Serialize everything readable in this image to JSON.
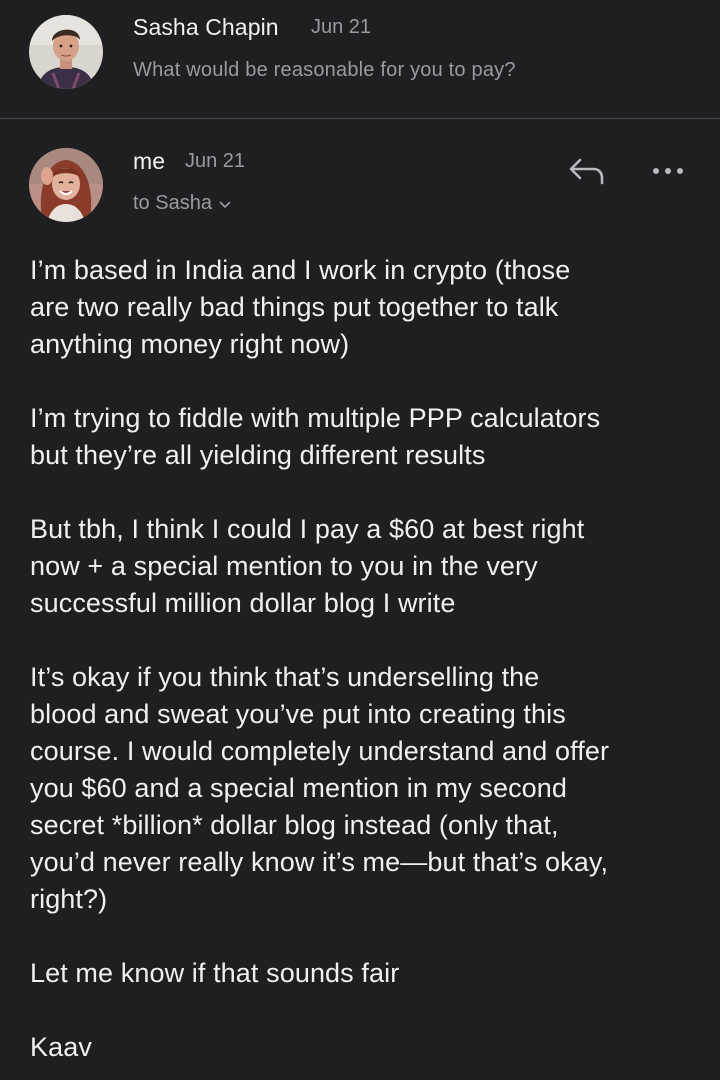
{
  "previous_message": {
    "sender": "Sasha Chapin",
    "date": "Jun 21",
    "snippet": "What would be reasonable for you to pay?"
  },
  "current_message": {
    "sender": "me",
    "date": "Jun 21",
    "recipient": "to Sasha",
    "actions": {
      "reply_icon": "reply-arrow-icon",
      "more_icon": "more-horizontal-icon"
    },
    "paragraphs": [
      "I’m based in India and I work in crypto (those\nare two really bad things put together to talk\nanything money right now)",
      "I’m trying to fiddle with multiple PPP calculators\nbut they’re all yielding different results",
      "But tbh, I think I could I pay a $60 at best right\nnow + a special mention to you in the very\nsuccessful million dollar blog I write",
      "It’s okay if you think that’s underselling the\nblood and sweat you’ve put into creating this\ncourse. I would completely understand and offer\nyou $60 and a special mention in my second\nsecret *billion* dollar blog instead (only that,\nyou’d never really know it’s me—but that’s okay,\nright?)",
      "Let me know if that sounds fair",
      "Kaav"
    ]
  },
  "colors": {
    "background": "#1f1f21",
    "primary_text": "#f0f0f2",
    "secondary_text": "#9a9a9f",
    "divider": "#4a4a4e"
  }
}
